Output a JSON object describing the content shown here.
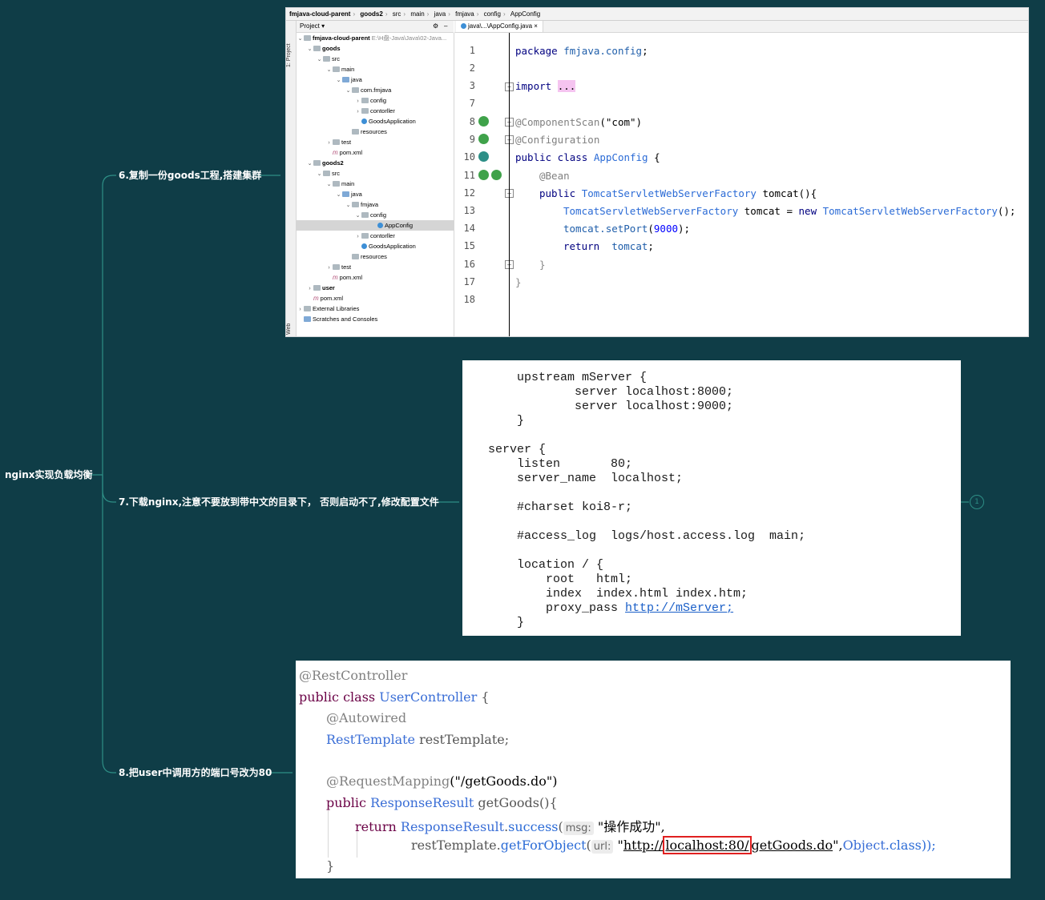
{
  "mindmap": {
    "root": "nginx实现负载均衡",
    "branches": [
      {
        "label": "6.复制一份goods工程,搭建集群"
      },
      {
        "label": "7.下载nginx,注意不要放到带中文的目录下， 否则启动不了,修改配置文件"
      },
      {
        "label": "8.把user中调用方的端口号改为80"
      }
    ],
    "collapsed_badge": "1"
  },
  "ide": {
    "breadcrumbs": [
      "fmjava-cloud-parent",
      "goods2",
      "src",
      "main",
      "java",
      "fmjava",
      "config",
      "AppConfig"
    ],
    "project_label": "Project",
    "side_tabs": [
      "1: Project",
      "Web"
    ],
    "tab_title": "java\\...\\AppConfig.java",
    "tree": [
      {
        "text": "fmjava-cloud-parent",
        "suffix": "E:\\H盘-Java\\Java\\02-Java..."
      },
      {
        "text": "goods"
      },
      {
        "text": "src"
      },
      {
        "text": "main"
      },
      {
        "text": "java"
      },
      {
        "text": "com.fmjava"
      },
      {
        "text": "config"
      },
      {
        "text": "contorller"
      },
      {
        "text": "GoodsApplication"
      },
      {
        "text": "resources"
      },
      {
        "text": "test"
      },
      {
        "text": "pom.xml"
      },
      {
        "text": "goods2"
      },
      {
        "text": "src"
      },
      {
        "text": "main"
      },
      {
        "text": "java"
      },
      {
        "text": "fmjava"
      },
      {
        "text": "config"
      },
      {
        "text": "AppConfig"
      },
      {
        "text": "contorller"
      },
      {
        "text": "GoodsApplication"
      },
      {
        "text": "resources"
      },
      {
        "text": "test"
      },
      {
        "text": "pom.xml"
      },
      {
        "text": "user"
      },
      {
        "text": "pom.xml"
      },
      {
        "text": "External Libraries"
      },
      {
        "text": "Scratches and Consoles"
      }
    ],
    "line_numbers": [
      "1",
      "2",
      "3",
      "7",
      "8",
      "9",
      "10",
      "11",
      "12",
      "13",
      "14",
      "15",
      "16",
      "17",
      "18"
    ],
    "code": {
      "l1a": "package ",
      "l1b": "fmjava.config",
      "l1c": ";",
      "l3a": "import ",
      "l3b": "...",
      "l8a": "@ComponentScan",
      "l8b": "(",
      "l8c": "\"com\"",
      "l8d": ")",
      "l9": "@Configuration",
      "l10a": "public class ",
      "l10b": "AppConfig",
      "l10c": " {",
      "l11": "@Bean",
      "l12a": "public ",
      "l12b": "TomcatServletWebServerFactory",
      "l12c": " tomcat",
      "l12d": "(){",
      "l13a": "TomcatServletWebServerFactory",
      "l13b": " tomcat = ",
      "l13c": "new ",
      "l13d": "TomcatServletWebServerFactory",
      "l13e": "();",
      "l14a": "tomcat.",
      "l14b": "setPort",
      "l14c": "(",
      "l14d": "9000",
      "l14e": ");",
      "l15a": "return ",
      "l15b": " tomcat",
      "l15c": ";",
      "l16": "}",
      "l17": "}"
    }
  },
  "nginx": {
    "lines": [
      "    upstream mServer {",
      "            server localhost:8000;",
      "            server localhost:9000;",
      "    }",
      "server {",
      "    listen       80;",
      "    server_name  localhost;",
      "    #charset koi8-r;",
      "    #access_log  logs/host.access.log  main;",
      "    location / {",
      "        root   html;",
      "        index  index.html index.htm;",
      "        proxy_pass ",
      "    }"
    ],
    "proxy_url": "http://mServer;"
  },
  "usercode": {
    "l1": "@RestController",
    "l2a": "public class ",
    "l2b": "UserController",
    "l2c": " {",
    "l3": "@Autowired",
    "l4a": "RestTemplate",
    "l4b": " restTemplate;",
    "l5a": "@RequestMapping",
    "l5b": "(",
    "l5c": "\"/getGoods.do\"",
    "l5d": ")",
    "l6a": "public ",
    "l6b": "ResponseResult",
    "l6c": " getGoods",
    "l6d": "(){",
    "l7a": "return ",
    "l7b": "ResponseResult",
    "l7c": ".",
    "l7d": "success",
    "l7e": "(",
    "l7hint": "msg:",
    "l7f": " \"操作成功\",",
    "l8a": "restTemplate.",
    "l8b": "getForObject",
    "l8c": "(",
    "l8hint": "url:",
    "l8d": " \"",
    "l8e": "http://",
    "l8f": "localhost:80/",
    "l8g": "getGoods.do",
    "l8h": "\",",
    "l8i": "Object",
    "l8j": ".class));",
    "l9": "}"
  }
}
